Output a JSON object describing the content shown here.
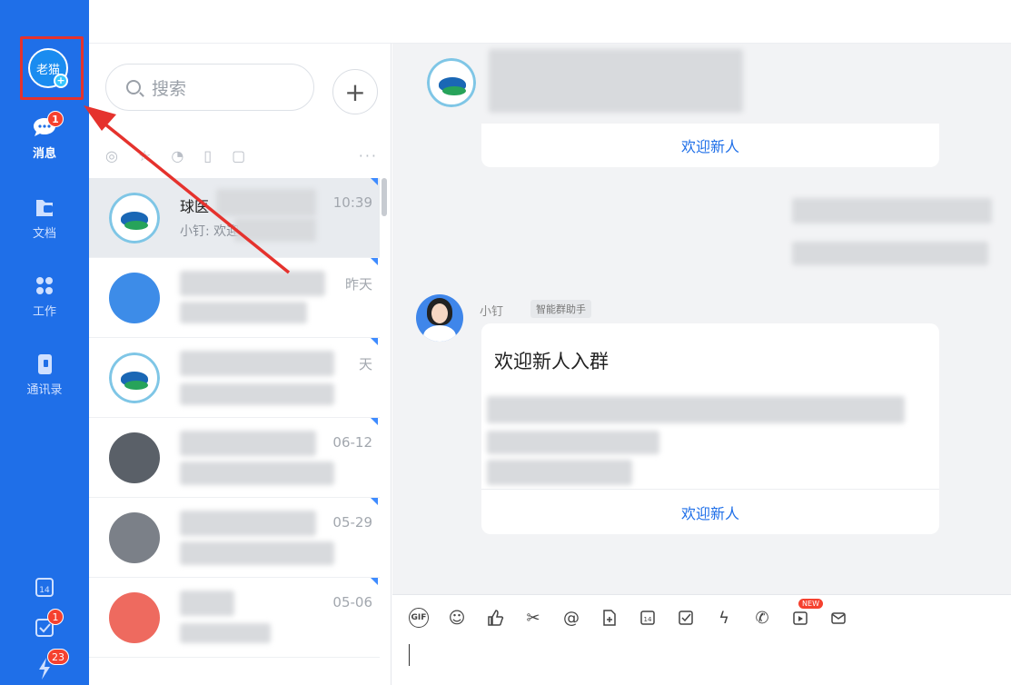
{
  "colors": {
    "rail_blue": "#1f6fe8",
    "badge_red": "#f5412f",
    "highlight_red": "#e5322d",
    "link_blue": "#1f6fe8"
  },
  "rail": {
    "me_avatar_text": "老猫",
    "items": [
      {
        "label": "消息",
        "icon": "chat-bubble-icon",
        "badge": "1"
      },
      {
        "label": "文档",
        "icon": "folder-icon"
      },
      {
        "label": "工作",
        "icon": "grid-apps-icon"
      },
      {
        "label": "通讯录",
        "icon": "contacts-book-icon"
      }
    ],
    "bottom": [
      {
        "icon": "calendar-icon",
        "text": "14"
      },
      {
        "icon": "todo-check-icon",
        "badge": "1"
      },
      {
        "icon": "lightning-icon",
        "badge": "23"
      }
    ]
  },
  "list": {
    "search_placeholder": "搜索",
    "plus_label": "+",
    "more_label": "···",
    "conversations": [
      {
        "title": "球医",
        "sub": "小钉: 欢迎",
        "time": "10:39"
      },
      {
        "title": "",
        "sub": "",
        "time": "昨天"
      },
      {
        "title": "",
        "sub": "",
        "time": "天"
      },
      {
        "title": "",
        "sub": "",
        "time": "06-12"
      },
      {
        "title": "",
        "sub": "",
        "time": "05-29"
      },
      {
        "title": "",
        "sub": "",
        "time": "05-06"
      }
    ]
  },
  "chat": {
    "welcome_top": "欢迎新人",
    "sender_name": "小钉",
    "sender_tag": "智能群助手",
    "card_title": "欢迎新人入群",
    "welcome_bottom": "欢迎新人"
  },
  "toolbar": {
    "tools": [
      "gif-icon",
      "emoji-icon",
      "thumbs-up-icon",
      "scissors-icon",
      "at-icon",
      "file-add-icon",
      "calendar-14-icon",
      "checkbox-icon",
      "lightning-icon",
      "phone-call-icon",
      "video-new-icon",
      "mail-icon"
    ],
    "gif_text": "GIF",
    "calendar_text": "14",
    "new_badge": "NEW"
  }
}
